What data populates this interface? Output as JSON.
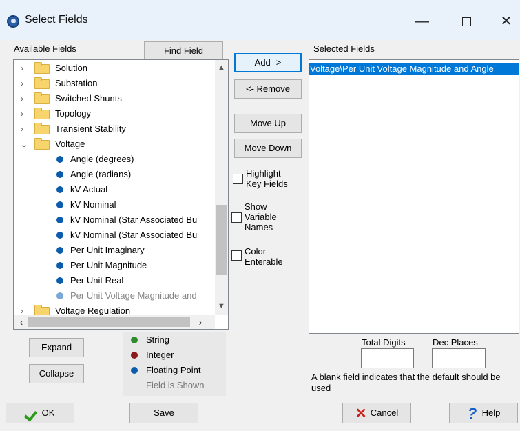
{
  "window": {
    "title": "Select Fields",
    "controls": {
      "minimize": "—",
      "maximize": "",
      "close": "✕"
    }
  },
  "available": {
    "label": "Available Fields",
    "find_button": "Find Field",
    "tree": [
      {
        "text": "Solution",
        "kind": "folder",
        "chevron": "›"
      },
      {
        "text": "Substation",
        "kind": "folder",
        "chevron": "›"
      },
      {
        "text": "Switched Shunts",
        "kind": "folder",
        "chevron": "›"
      },
      {
        "text": "Topology",
        "kind": "folder",
        "chevron": "›"
      },
      {
        "text": "Transient Stability",
        "kind": "folder",
        "chevron": "›"
      },
      {
        "text": "Voltage",
        "kind": "folder",
        "chevron": "⌄"
      },
      {
        "text": "Angle (degrees)",
        "kind": "leaf"
      },
      {
        "text": "Angle (radians)",
        "kind": "leaf"
      },
      {
        "text": "kV Actual",
        "kind": "leaf"
      },
      {
        "text": "kV Nominal",
        "kind": "leaf"
      },
      {
        "text": "kV Nominal (Star Associated Bu",
        "kind": "leaf"
      },
      {
        "text": "kV Nominal (Star Associated Bu",
        "kind": "leaf"
      },
      {
        "text": "Per Unit Imaginary",
        "kind": "leaf"
      },
      {
        "text": "Per Unit Magnitude",
        "kind": "leaf"
      },
      {
        "text": "Per Unit Real",
        "kind": "leaf"
      },
      {
        "text": "Per Unit Voltage Magnitude and",
        "kind": "leaf",
        "dim": true
      },
      {
        "text": "Voltage Regulation",
        "kind": "folder",
        "chevron": "›"
      }
    ],
    "scroll": {
      "up": "▲",
      "down": "▼",
      "left": "‹",
      "right": "›"
    }
  },
  "tree_buttons": {
    "expand": "Expand",
    "collapse": "Collapse"
  },
  "legend": {
    "items": [
      {
        "label": "String",
        "color": "#2e8b2e"
      },
      {
        "label": "Integer",
        "color": "#8b1a1a"
      },
      {
        "label": "Floating Point",
        "color": "#0b5cad"
      }
    ],
    "note": "Field is Shown"
  },
  "middle": {
    "add": "Add ->",
    "remove": "<- Remove",
    "move_up": "Move Up",
    "move_down": "Move Down",
    "highlight_key_1": "Highlight",
    "highlight_key_2": "Key Fields",
    "show_var_1": "Show",
    "show_var_2": "Variable",
    "show_var_3": "Names",
    "color_ent_1": "Color",
    "color_ent_2": "Enterable"
  },
  "selected": {
    "label": "Selected Fields",
    "items": [
      "Voltage\\Per Unit Voltage Magnitude and Angle"
    ]
  },
  "format": {
    "total_digits_label": "Total Digits",
    "dec_places_label": "Dec Places",
    "total_digits_value": "",
    "dec_places_value": "",
    "hint": "A blank field indicates that the default should be used"
  },
  "footer": {
    "ok": "OK",
    "save": "Save",
    "cancel": "Cancel",
    "help": "Help"
  },
  "colors": {
    "accent": "#0078d7",
    "titlebar": "#e9f2fb",
    "dialog_bg": "#f0f0f0"
  }
}
